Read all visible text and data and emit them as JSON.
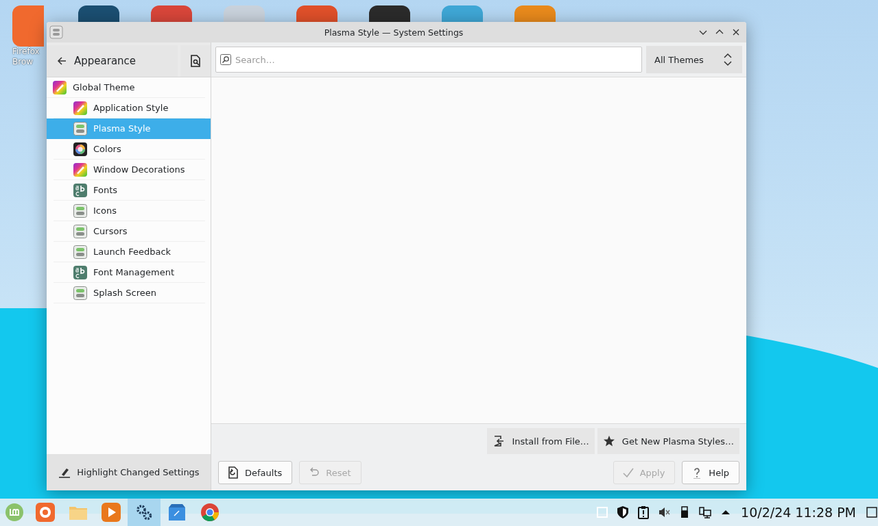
{
  "desktop": {
    "icons": [
      {
        "label_lines": [
          "Firefox",
          "Brow"
        ],
        "color": "#f0692e"
      },
      {
        "color": "#1b4f72"
      },
      {
        "color": "#d9463a"
      },
      {
        "color": "#c9d2dc"
      },
      {
        "color": "#e0502a"
      },
      {
        "color": "#2b2b2b"
      },
      {
        "color": "#3fa7d6"
      },
      {
        "color": "#e98a1c"
      }
    ]
  },
  "window": {
    "title": "Plasma Style — System Settings"
  },
  "sidebar": {
    "back_label": "Appearance",
    "items": [
      {
        "label": "Global Theme",
        "kind": "brush",
        "selected": false,
        "children": [
          {
            "label": "Application Style",
            "kind": "brush",
            "selected": false
          },
          {
            "label": "Plasma Style",
            "kind": "toggle",
            "selected": true
          },
          {
            "label": "Colors",
            "kind": "wheel",
            "selected": false
          },
          {
            "label": "Window Decorations",
            "kind": "brush",
            "selected": false
          },
          {
            "label": "Fonts",
            "kind": "font",
            "selected": false
          },
          {
            "label": "Icons",
            "kind": "toggle",
            "selected": false
          },
          {
            "label": "Cursors",
            "kind": "toggle",
            "selected": false
          },
          {
            "label": "Launch Feedback",
            "kind": "toggle",
            "selected": false
          },
          {
            "label": "Font Management",
            "kind": "font",
            "selected": false
          },
          {
            "label": "Splash Screen",
            "kind": "toggle",
            "selected": false
          }
        ]
      }
    ],
    "footer_label": "Highlight Changed Settings"
  },
  "search": {
    "placeholder": "Search…"
  },
  "filter": {
    "value": "All Themes"
  },
  "actions": [
    {
      "label": "Install from File…",
      "kind": "import"
    },
    {
      "label": "Get New Plasma Styles…",
      "kind": "star"
    }
  ],
  "buttons_left": [
    {
      "label": "Defaults",
      "kind": "defaults",
      "disabled": false
    },
    {
      "label": "Reset",
      "kind": "reset",
      "disabled": true
    }
  ],
  "buttons_right": [
    {
      "label": "Apply",
      "kind": "apply",
      "disabled": true
    },
    {
      "label": "Help",
      "kind": "help",
      "disabled": false
    }
  ],
  "taskbar": {
    "tasks": [
      {
        "kind": "firefox",
        "active": false
      },
      {
        "kind": "folder",
        "active": false
      },
      {
        "kind": "media",
        "active": false
      },
      {
        "kind": "settings",
        "active": true
      },
      {
        "kind": "store",
        "active": false
      },
      {
        "kind": "chrome",
        "active": false
      }
    ],
    "clock": "10/2/24 11:28 PM"
  }
}
